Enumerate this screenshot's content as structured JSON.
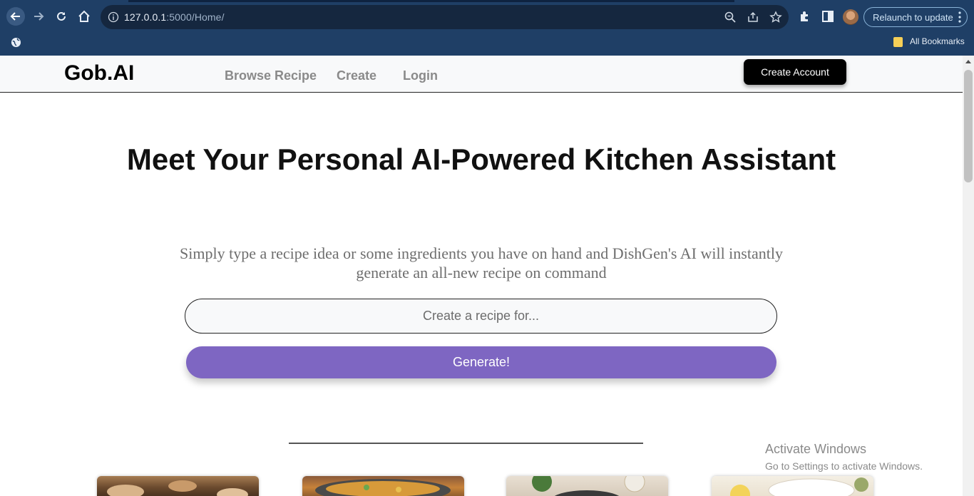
{
  "browser": {
    "url_host": "127.0.0.1",
    "url_rest": ":5000/Home/",
    "relaunch_label": "Relaunch to update",
    "bookmarks_label": "All Bookmarks"
  },
  "site": {
    "brand": "Gob.AI",
    "nav": [
      {
        "label": "Browse Recipe"
      },
      {
        "label": "Create"
      },
      {
        "label": "Login"
      }
    ],
    "create_account_label": "Create Account"
  },
  "hero": {
    "title": "Meet Your Personal AI-Powered Kitchen Assistant",
    "subtitle": "Simply type a recipe idea or some ingredients you have on hand and DishGen's AI will instantly generate an all-new recipe on command"
  },
  "search": {
    "placeholder": "Create a recipe for...",
    "value": ""
  },
  "generate_label": "Generate!",
  "windows_watermark": {
    "line1": "Activate Windows",
    "line2": "Go to Settings to activate Windows."
  },
  "colors": {
    "chrome_bg": "#1f3f66",
    "generate_bg": "#7e66c2",
    "create_account_bg": "#000000"
  }
}
